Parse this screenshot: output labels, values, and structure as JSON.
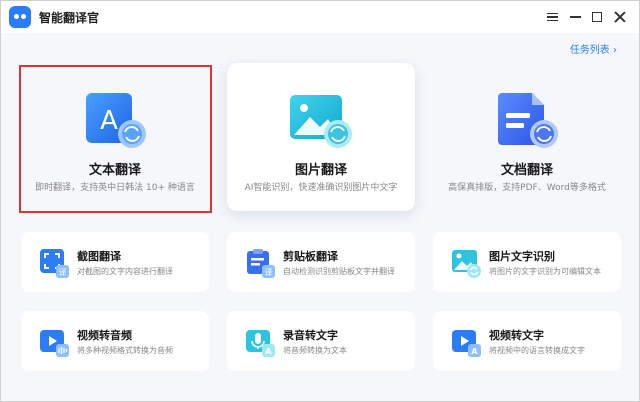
{
  "window": {
    "title": "智能翻译官"
  },
  "header": {
    "task_list": "任务列表 ›"
  },
  "big_cards": [
    {
      "title": "文本翻译",
      "desc": "即时翻译，支持英中日韩法 10+ 种语言",
      "icon": "text-translate-icon"
    },
    {
      "title": "图片翻译",
      "desc": "AI智能识别，快速准确识别图片中文字",
      "icon": "image-translate-icon"
    },
    {
      "title": "文档翻译",
      "desc": "高保真排版，支持PDF、Word等多格式",
      "icon": "document-translate-icon"
    }
  ],
  "small_cards": [
    {
      "title": "截图翻译",
      "desc": "对截图的文字内容进行翻译",
      "icon": "screenshot-translate-icon"
    },
    {
      "title": "剪贴板翻译",
      "desc": "自动检测识别剪贴板文字并翻译",
      "icon": "clipboard-translate-icon"
    },
    {
      "title": "图片文字识别",
      "desc": "将图片的文字识别为可编辑文本",
      "icon": "image-ocr-icon"
    },
    {
      "title": "视频转音频",
      "desc": "将多种视频格式转换为音频",
      "icon": "video-to-audio-icon"
    },
    {
      "title": "录音转文字",
      "desc": "将音频转换为文本",
      "icon": "audio-to-text-icon"
    },
    {
      "title": "视频转文字",
      "desc": "将视频中的语言转换成文字",
      "icon": "video-to-text-icon"
    }
  ],
  "icon_letters": {
    "text_a": "A",
    "badge_translate": "译",
    "badge_a": "A"
  },
  "colors": {
    "accent": "#2a7df6",
    "cyan": "#2cc5e0",
    "selection": "#e03131"
  }
}
